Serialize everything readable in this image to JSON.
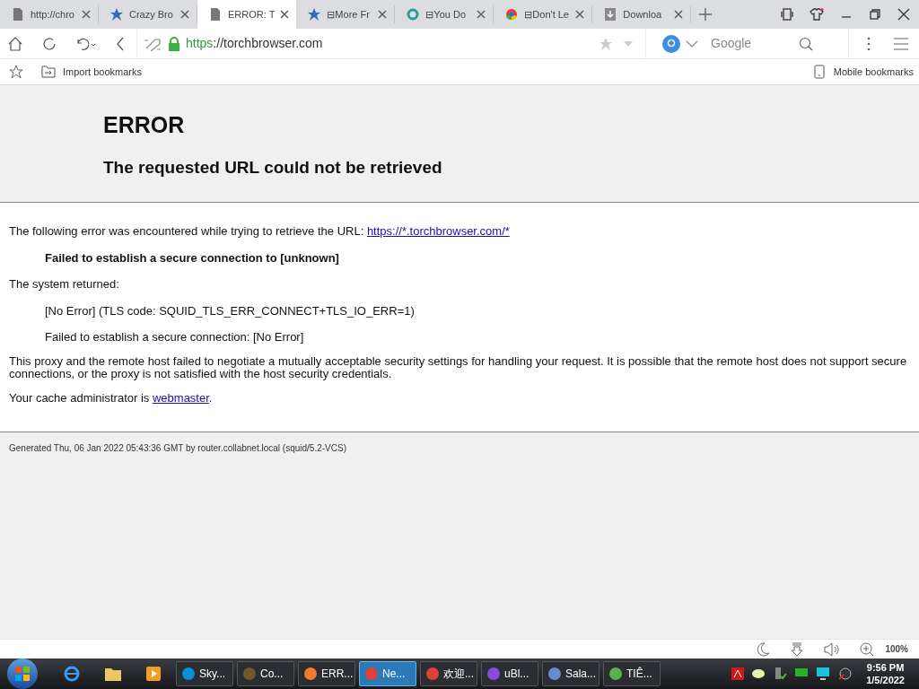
{
  "tabs": [
    {
      "label": "http://chro",
      "kind": "page",
      "selected": false
    },
    {
      "label": "Crazy Bro",
      "kind": "star",
      "selected": false
    },
    {
      "label": "ERROR: T",
      "kind": "page",
      "selected": true
    },
    {
      "label": "⊟More Fr",
      "kind": "star",
      "selected": false
    },
    {
      "label": "⊟You Do",
      "kind": "ring",
      "selected": false
    },
    {
      "label": "⊟Don't Le",
      "kind": "chrome",
      "selected": false
    },
    {
      "label": "Downloa",
      "kind": "download",
      "selected": false
    }
  ],
  "address": {
    "scheme": "https",
    "rest": "://torchbrowser.com"
  },
  "search": {
    "placeholder": "Google"
  },
  "bookmarks": {
    "import": "Import bookmarks",
    "mobile": "Mobile bookmarks"
  },
  "page": {
    "title": "ERROR",
    "subtitle": "The requested URL could not be retrieved",
    "intro": "The following error was encountered while trying to retrieve the URL:",
    "intro_link": "https://*.torchbrowser.com/*",
    "error": "Failed to establish a secure connection to [unknown]",
    "returned": "The system returned:",
    "details": [
      "[No Error] (TLS code: SQUID_TLS_ERR_CONNECT+TLS_IO_ERR=1)",
      "Failed to establish a secure connection: [No Error]"
    ],
    "explanation": "This proxy and the remote host failed to negotiate a mutually acceptable security settings for handling your request. It is possible that the remote host does not support secure connections, or the proxy is not satisfied with the host security credentials.",
    "admin": "Your cache administrator is",
    "admin_link": "webmaster",
    "admin_end": ".",
    "footer": "Generated Thu, 06 Jan 2022 05:43:36 GMT by router.collabnet.local (squid/5.2-VCS)"
  },
  "status_bar": {
    "zoom": "100%"
  },
  "taskbar": {
    "items": [
      {
        "label": "Sky...",
        "color": "#0a8fd8",
        "selected": false
      },
      {
        "label": "Co...",
        "color": "#6b5a2a",
        "selected": false
      },
      {
        "label": "ERR...",
        "color": "#f07a2a",
        "selected": false
      },
      {
        "label": "Ne...",
        "color": "#e0403a",
        "selected": true
      },
      {
        "label": "欢迎...",
        "color": "#e0403a",
        "selected": false
      },
      {
        "label": "uBl...",
        "color": "#8a4ae0",
        "selected": false
      },
      {
        "label": "Sala...",
        "color": "#6a8ad0",
        "selected": false
      },
      {
        "label": "TIÊ...",
        "color": "#5ab04a",
        "selected": false
      }
    ],
    "time": "9:56 PM",
    "date": "1/5/2022"
  }
}
